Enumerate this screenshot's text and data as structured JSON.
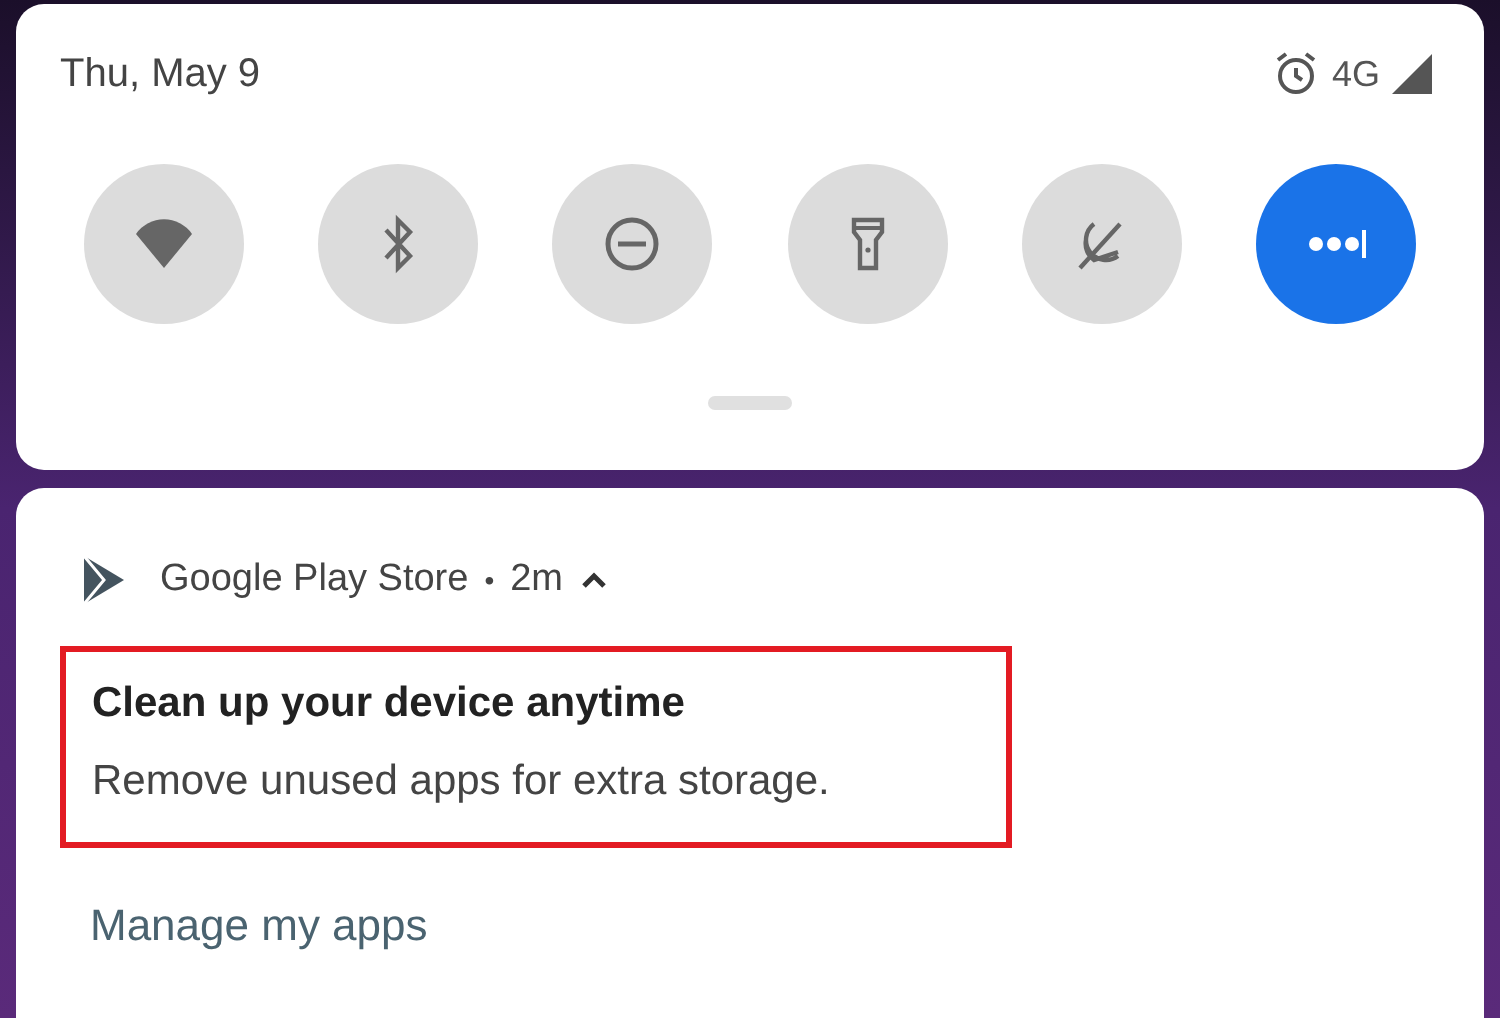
{
  "status_bar": {
    "date": "Thu, May 9",
    "network": "4G"
  },
  "quick_tiles": [
    {
      "kind": "wifi",
      "on": false
    },
    {
      "kind": "bluetooth",
      "on": false
    },
    {
      "kind": "dnd",
      "on": false
    },
    {
      "kind": "flashlight",
      "on": false
    },
    {
      "kind": "autorotate",
      "on": false
    },
    {
      "kind": "more",
      "on": true
    }
  ],
  "notification": {
    "app": "Google Play Store",
    "separator": "•",
    "time": "2m",
    "expanded": true,
    "highlighted": true,
    "title": "Clean up your device anytime",
    "body": "Remove unused apps for extra storage.",
    "actions": [
      "Manage my apps"
    ]
  }
}
